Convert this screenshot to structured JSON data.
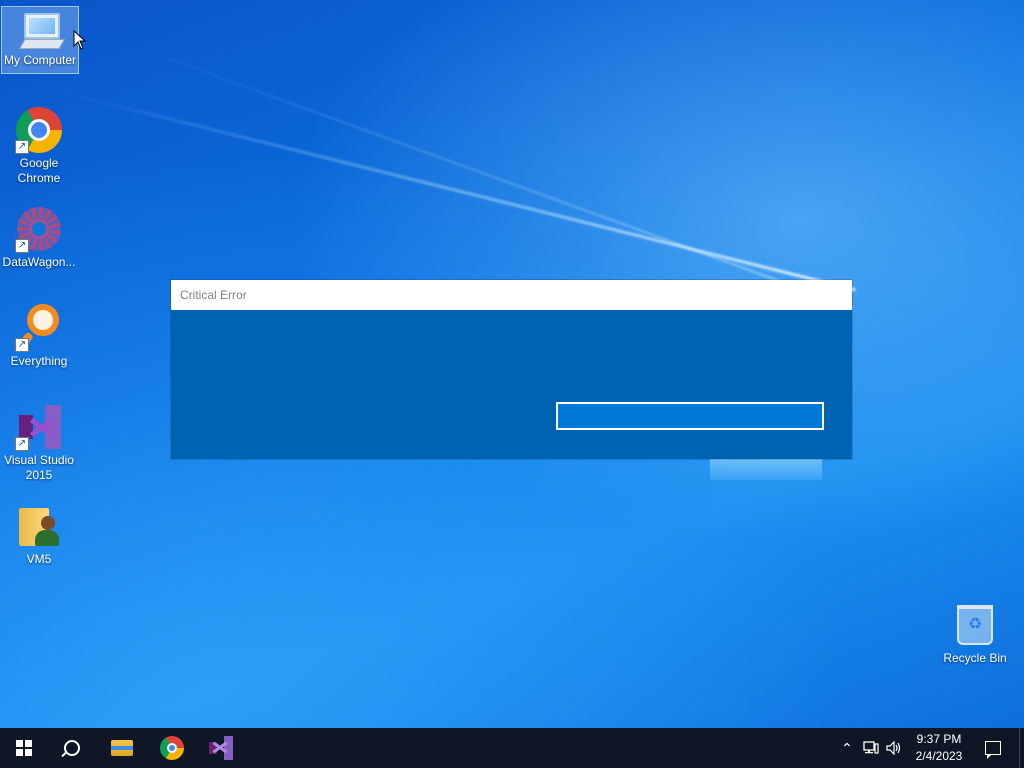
{
  "desktop_icons": [
    {
      "label": "My Computer",
      "icon": "computer-icon",
      "selected": true
    },
    {
      "label": "Google Chrome",
      "icon": "chrome-icon"
    },
    {
      "label": "DataWagon...",
      "icon": "datawagon-icon"
    },
    {
      "label": "Everything",
      "icon": "everything-icon"
    },
    {
      "label": "Visual Studio 2015",
      "icon": "visual-studio-icon"
    },
    {
      "label": "VM5",
      "icon": "user-folder-icon"
    },
    {
      "label": "Recycle Bin",
      "icon": "recycle-bin-icon"
    }
  ],
  "labels": {
    "my_computer": "My Computer",
    "chrome_line1": "Google",
    "chrome_line2": "Chrome",
    "datawagon": "DataWagon...",
    "everything": "Everything",
    "vs_line1": "Visual Studio",
    "vs_line2": "2015",
    "vm5": "VM5",
    "recycle_bin": "Recycle Bin"
  },
  "dialog": {
    "title": "Critical Error",
    "button_label": "",
    "colors": {
      "body": "#0063b1",
      "button": "#0078d7",
      "titlebar": "#ffffff"
    }
  },
  "taskbar": {
    "pinned": [
      "windows-start-icon",
      "search-icon",
      "file-explorer-icon",
      "chrome-icon",
      "visual-studio-icon"
    ],
    "tray_icons": [
      "chevron-up-icon",
      "network-icon",
      "volume-icon"
    ],
    "time": "9:37 PM",
    "date": "2/4/2023",
    "notification_icon": "action-center-icon",
    "background": "#0f1726"
  }
}
